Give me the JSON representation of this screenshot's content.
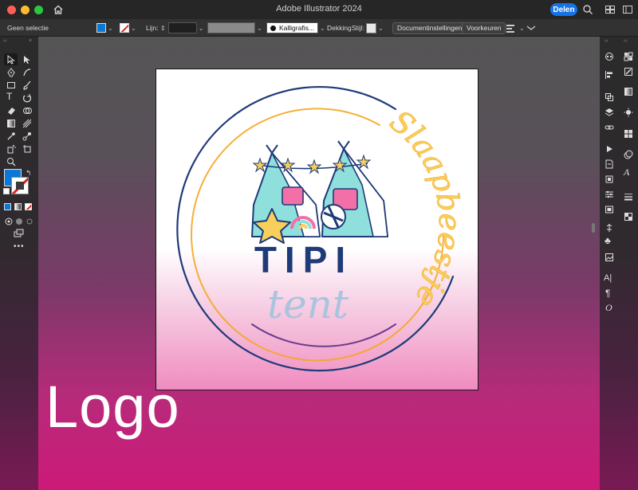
{
  "window": {
    "title": "Adobe Illustrator 2024",
    "share_label": "Delen",
    "traffic_colors": [
      "#ff5f57",
      "#febc2e",
      "#28c840"
    ]
  },
  "control_bar": {
    "selection": "Geen selectie",
    "stroke_label": "Lijn:",
    "brush_label": "Kalligrafis...",
    "opacity_label": "Dekking",
    "style_label": "Stijl:",
    "document_settings": "Documentinstellingen",
    "preferences": "Voorkeuren"
  },
  "colors": {
    "fill": "#0a78d4",
    "stroke_none": "#e02020",
    "accent": "#1473e6",
    "navy": "#1e3a78",
    "orange": "#f5a623",
    "yellow": "#f7cf5a"
  },
  "logo": {
    "title": "TIPI",
    "subtitle": "tent",
    "script": "Slaapbeestje"
  },
  "overlay": {
    "caption": "Logo"
  }
}
